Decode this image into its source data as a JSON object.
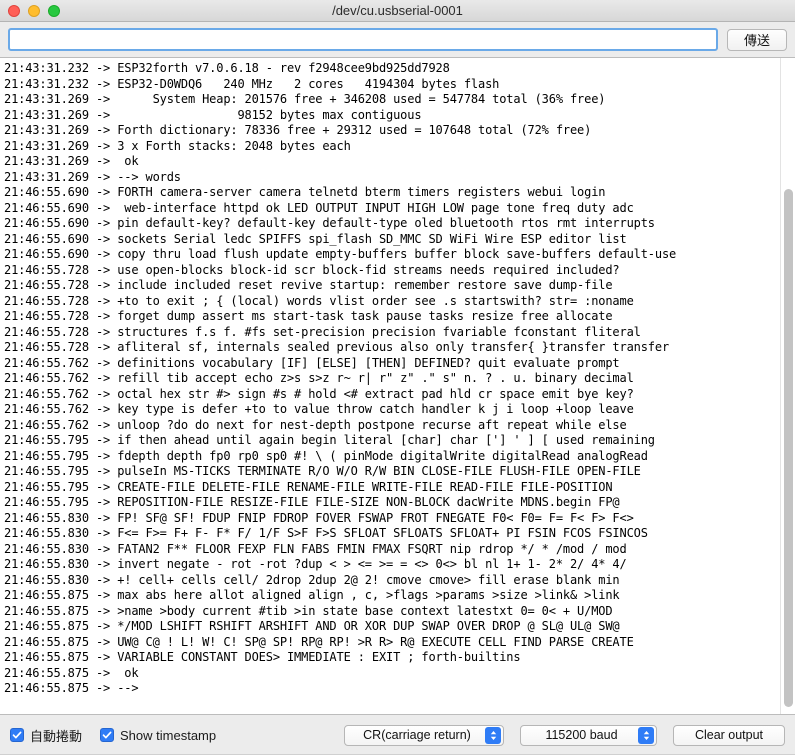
{
  "window": {
    "title": "/dev/cu.usbserial-0001",
    "traffic_lights": [
      {
        "name": "close",
        "color": "#ff5f57"
      },
      {
        "name": "minimize",
        "color": "#ffbd2e"
      },
      {
        "name": "maximize",
        "color": "#28c840"
      }
    ]
  },
  "send_row": {
    "input_value": "",
    "input_placeholder": "",
    "send_label": "傳送"
  },
  "terminal": {
    "lines": [
      "21:43:31.232 -> ESP32forth v7.0.6.18 - rev f2948cee9bd925dd7928",
      "21:43:31.232 -> ESP32-D0WDQ6   240 MHz   2 cores   4194304 bytes flash",
      "21:43:31.269 ->      System Heap: 201576 free + 346208 used = 547784 total (36% free)",
      "21:43:31.269 ->                  98152 bytes max contiguous",
      "21:43:31.269 -> Forth dictionary: 78336 free + 29312 used = 107648 total (72% free)",
      "21:43:31.269 -> 3 x Forth stacks: 2048 bytes each",
      "21:43:31.269 ->  ok",
      "21:43:31.269 -> --> words",
      "21:46:55.690 -> FORTH camera-server camera telnetd bterm timers registers webui login",
      "21:46:55.690 ->  web-interface httpd ok LED OUTPUT INPUT HIGH LOW page tone freq duty adc",
      "21:46:55.690 -> pin default-key? default-key default-type oled bluetooth rtos rmt interrupts",
      "21:46:55.690 -> sockets Serial ledc SPIFFS spi_flash SD_MMC SD WiFi Wire ESP editor list",
      "21:46:55.690 -> copy thru load flush update empty-buffers buffer block save-buffers default-use",
      "21:46:55.728 -> use open-blocks block-id scr block-fid streams needs required included?",
      "21:46:55.728 -> include included reset revive startup: remember restore save dump-file",
      "21:46:55.728 -> +to to exit ; { (local) words vlist order see .s startswith? str= :noname",
      "21:46:55.728 -> forget dump assert ms start-task task pause tasks resize free allocate",
      "21:46:55.728 -> structures f.s f. #fs set-precision precision fvariable fconstant fliteral",
      "21:46:55.728 -> afliteral sf, internals sealed previous also only transfer{ }transfer transfer",
      "21:46:55.762 -> definitions vocabulary [IF] [ELSE] [THEN] DEFINED? quit evaluate prompt",
      "21:46:55.762 -> refill tib accept echo z>s s>z r~ r| r\" z\" .\" s\" n. ? . u. binary decimal",
      "21:46:55.762 -> octal hex str #> sign #s # hold <# extract pad hld cr space emit bye key?",
      "21:46:55.762 -> key type is defer +to to value throw catch handler k j i loop +loop leave",
      "21:46:55.762 -> unloop ?do do next for nest-depth postpone recurse aft repeat while else",
      "21:46:55.795 -> if then ahead until again begin literal [char] char ['] ' ] [ used remaining",
      "21:46:55.795 -> fdepth depth fp0 rp0 sp0 #! \\ ( pinMode digitalWrite digitalRead analogRead",
      "21:46:55.795 -> pulseIn MS-TICKS TERMINATE R/O W/O R/W BIN CLOSE-FILE FLUSH-FILE OPEN-FILE",
      "21:46:55.795 -> CREATE-FILE DELETE-FILE RENAME-FILE WRITE-FILE READ-FILE FILE-POSITION",
      "21:46:55.795 -> REPOSITION-FILE RESIZE-FILE FILE-SIZE NON-BLOCK dacWrite MDNS.begin FP@",
      "21:46:55.830 -> FP! SF@ SF! FDUP FNIP FDROP FOVER FSWAP FROT FNEGATE F0< F0= F= F< F> F<>",
      "21:46:55.830 -> F<= F>= F+ F- F* F/ 1/F S>F F>S SFLOAT SFLOATS SFLOAT+ PI FSIN FCOS FSINCOS",
      "21:46:55.830 -> FATAN2 F** FLOOR FEXP FLN FABS FMIN FMAX FSQRT nip rdrop */ * /mod / mod",
      "21:46:55.830 -> invert negate - rot -rot ?dup < > <= >= = <> 0<> bl nl 1+ 1- 2* 2/ 4* 4/",
      "21:46:55.830 -> +! cell+ cells cell/ 2drop 2dup 2@ 2! cmove cmove> fill erase blank min",
      "21:46:55.875 -> max abs here allot aligned align , c, >flags >params >size >link& >link",
      "21:46:55.875 -> >name >body current #tib >in state base context latestxt 0= 0< + U/MOD",
      "21:46:55.875 -> */MOD LSHIFT RSHIFT ARSHIFT AND OR XOR DUP SWAP OVER DROP @ SL@ UL@ SW@",
      "21:46:55.875 -> UW@ C@ ! L! W! C! SP@ SP! RP@ RP! >R R> R@ EXECUTE CELL FIND PARSE CREATE",
      "21:46:55.875 -> VARIABLE CONSTANT DOES> IMMEDIATE : EXIT ; forth-builtins",
      "21:46:55.875 ->  ok",
      "21:46:55.875 -> -->"
    ],
    "scrollbar": {
      "thumb_top_pct": 20,
      "thumb_height_pct": 79
    }
  },
  "bottom_bar": {
    "autoscroll": {
      "label": "自動捲動",
      "checked": true
    },
    "show_timestamp": {
      "label": "Show timestamp",
      "checked": true
    },
    "line_ending": {
      "selected": "CR(carriage return)"
    },
    "baud_rate": {
      "selected": "115200 baud"
    },
    "clear_output_label": "Clear output"
  }
}
